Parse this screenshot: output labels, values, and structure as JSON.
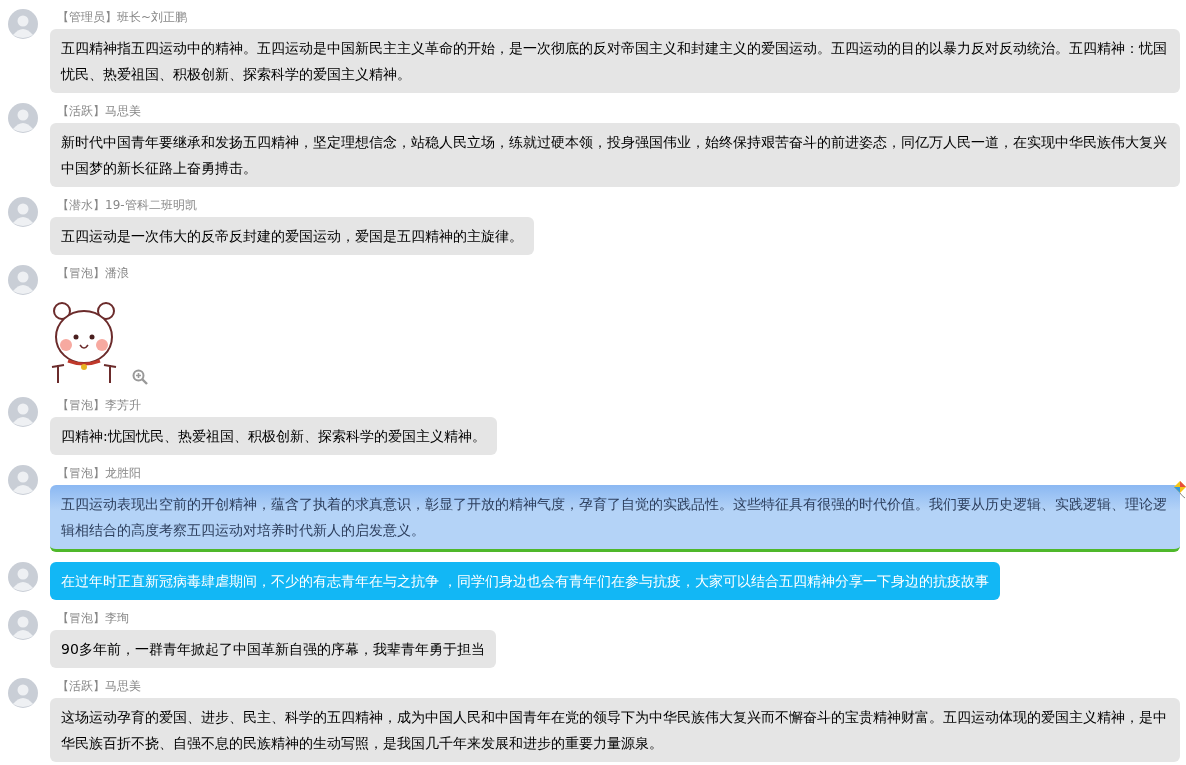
{
  "messages": [
    {
      "kind": "plain",
      "sender": "【管理员】班长~刘正鹏",
      "text": "五四精神指五四运动中的精神。五四运动是中国新民主主义革命的开始，是一次彻底的反对帝国主义和封建主义的爱国运动。五四运动的目的以暴力反对反动统治。五四精神：忧国忧民、热爱祖国、积极创新、探索科学的爱国主义精神。"
    },
    {
      "kind": "plain",
      "sender": "【活跃】马思美",
      "text": "新时代中国青年要继承和发扬五四精神，坚定理想信念，站稳人民立场，练就过硬本领，投身强国伟业，始终保持艰苦奋斗的前进姿态，同亿万人民一道，在实现中华民族伟大复兴中国梦的新长征路上奋勇搏击。"
    },
    {
      "kind": "plain",
      "sender": "【潜水】19-管科二班明凯",
      "text": "五四运动是一次伟大的反帝反封建的爱国运动，爱国是五四精神的主旋律。"
    },
    {
      "kind": "sticker",
      "sender": "【冒泡】潘浪"
    },
    {
      "kind": "plain",
      "sender": "【冒泡】李芳升",
      "text": "四精神:忧国忧民、热爱祖国、积极创新、探索科学的爱国主义精神。"
    },
    {
      "kind": "theme",
      "sender": "【冒泡】龙胜阳",
      "text": "五四运动表现出空前的开创精神，蕴含了执着的求真意识，彰显了开放的精神气度，孕育了自觉的实践品性。这些特征具有很强的时代价值。我们要从历史逻辑、实践逻辑、理论逻辑相结合的高度考察五四运动对培养时代新人的启发意义。"
    },
    {
      "kind": "highlight",
      "text": "在过年时正直新冠病毒肆虐期间，不少的有志青年在与之抗争 ，同学们身边也会有青年们在参与抗疫，大家可以结合五四精神分享一下身边的抗疫故事"
    },
    {
      "kind": "plain",
      "sender": "【冒泡】李珣",
      "text": "90多年前，一群青年掀起了中国革新自强的序幕，我辈青年勇于担当"
    },
    {
      "kind": "plain",
      "sender": "【活跃】马思美",
      "text": "这场运动孕育的爱国、进步、民主、科学的五四精神，成为中国人民和中国青年在党的领导下为中华民族伟大复兴而不懈奋斗的宝贵精神财富。五四运动体现的爱国主义精神，是中华民族百折不挠、自强不息的民族精神的生动写照，是我国几千年来发展和进步的重要力量源泉。"
    }
  ]
}
